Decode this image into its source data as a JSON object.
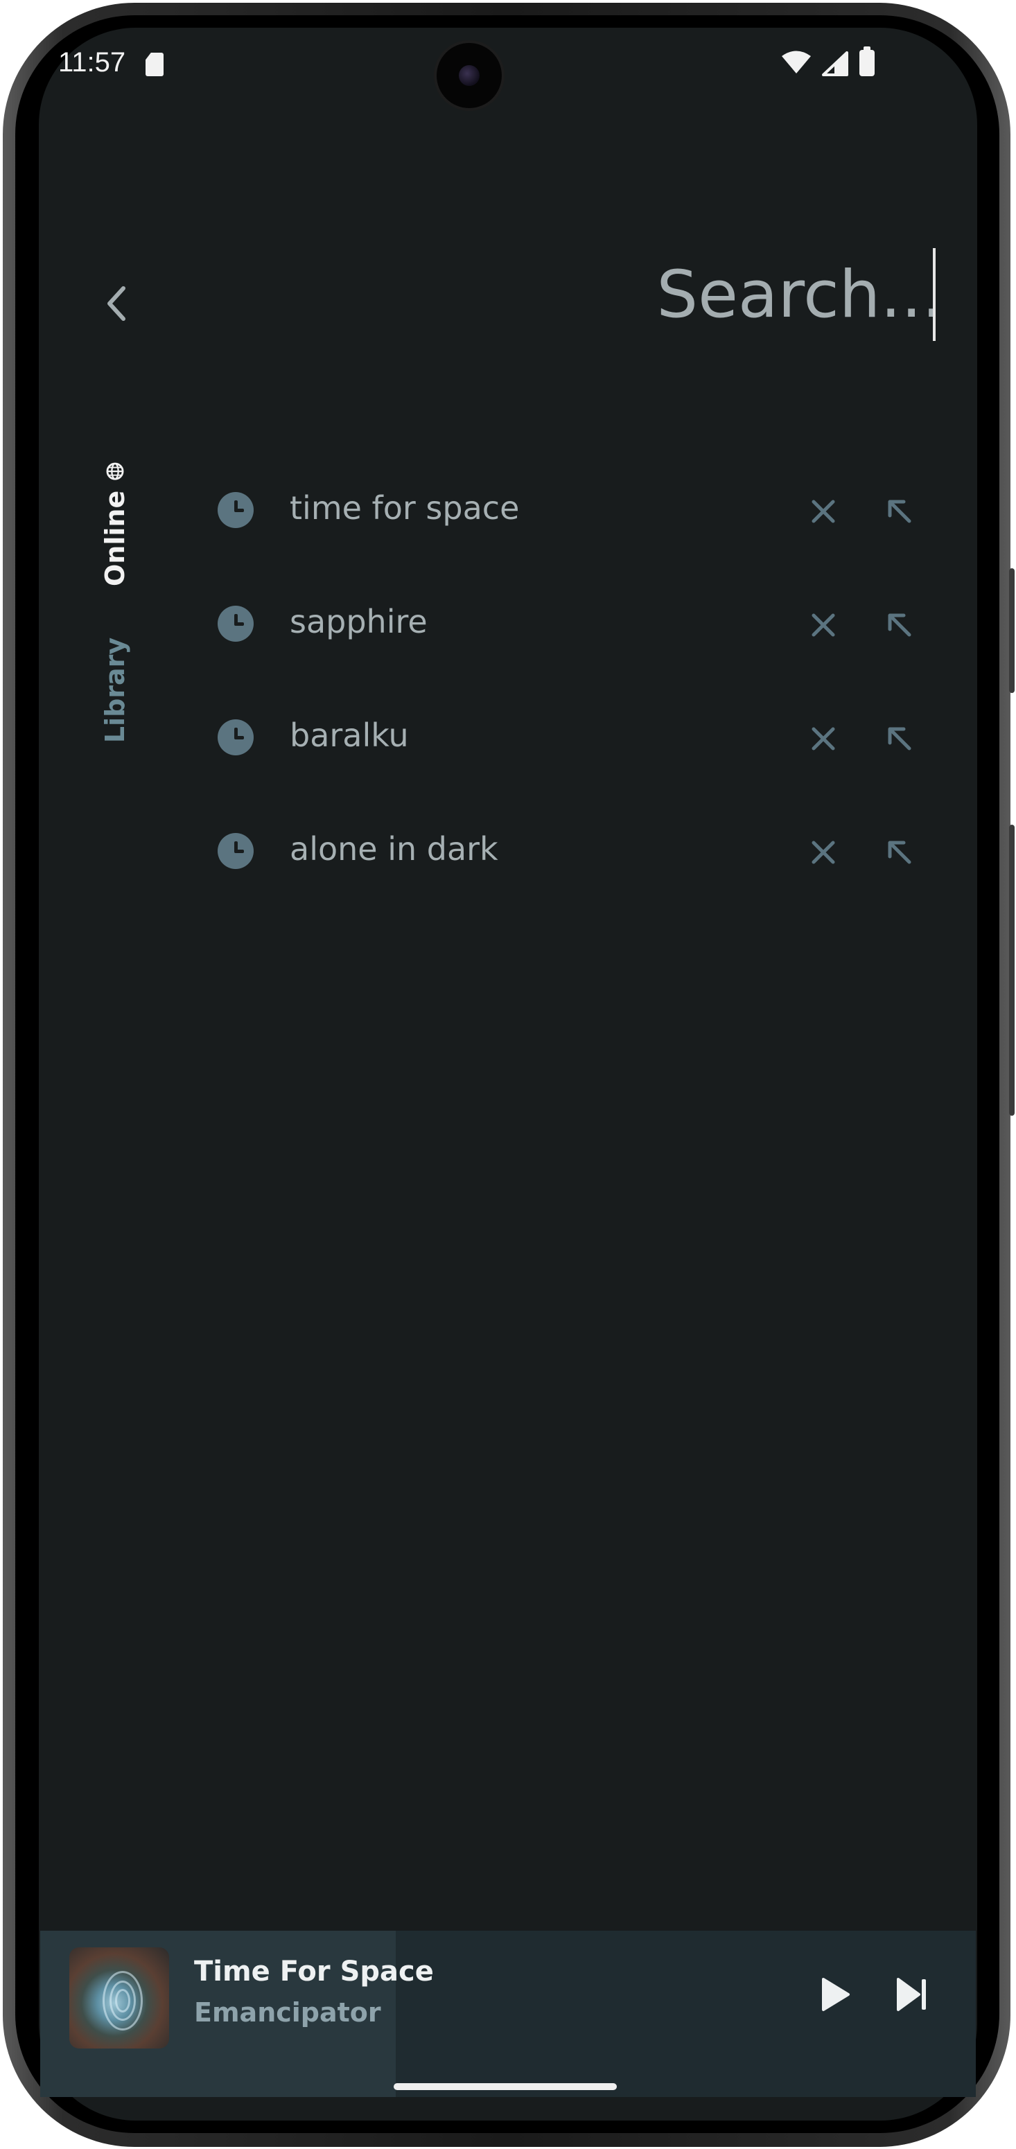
{
  "status_bar": {
    "time": "11:57",
    "icons": [
      "sd-card-icon",
      "wifi-icon",
      "signal-icon",
      "battery-icon"
    ]
  },
  "search": {
    "placeholder": "Search...",
    "value": ""
  },
  "tabs": [
    {
      "label": "Online",
      "icon": "globe-icon",
      "active": true
    },
    {
      "label": "Library",
      "active": false
    }
  ],
  "history": [
    {
      "text": "time for space"
    },
    {
      "text": "sapphire"
    },
    {
      "text": "baralku"
    },
    {
      "text": "alone in dark"
    }
  ],
  "mini_player": {
    "title": "Time For Space",
    "artist": "Emancipator",
    "progress": 0.38,
    "state": "paused"
  },
  "colors": {
    "background": "#181c1d",
    "accent": "#5b7480",
    "player_bg": "#1f2b30",
    "text_primary": "#eef1f2",
    "text_muted": "#a6b0b3"
  }
}
